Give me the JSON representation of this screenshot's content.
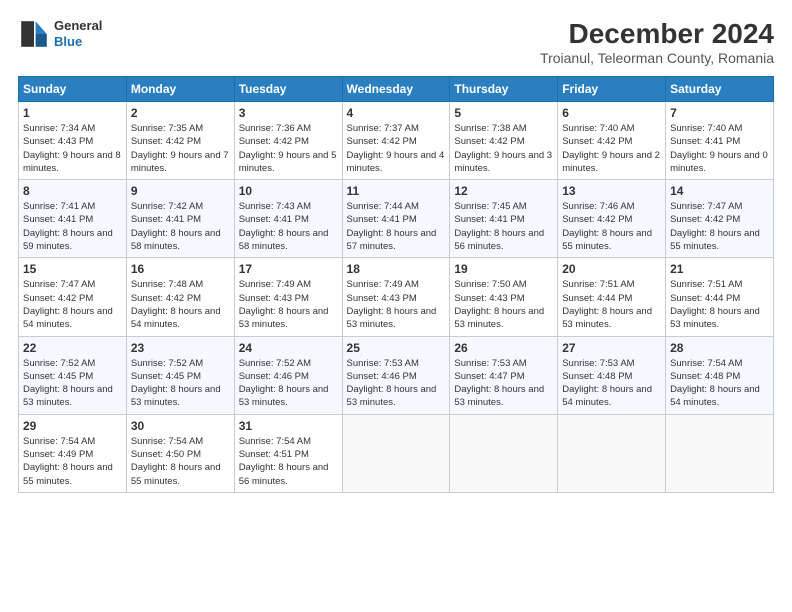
{
  "header": {
    "logo_line1": "General",
    "logo_line2": "Blue",
    "month": "December 2024",
    "location": "Troianul, Teleorman County, Romania"
  },
  "weekdays": [
    "Sunday",
    "Monday",
    "Tuesday",
    "Wednesday",
    "Thursday",
    "Friday",
    "Saturday"
  ],
  "weeks": [
    [
      {
        "day": "1",
        "sunrise": "7:34 AM",
        "sunset": "4:43 PM",
        "daylight": "9 hours and 8 minutes."
      },
      {
        "day": "2",
        "sunrise": "7:35 AM",
        "sunset": "4:42 PM",
        "daylight": "9 hours and 7 minutes."
      },
      {
        "day": "3",
        "sunrise": "7:36 AM",
        "sunset": "4:42 PM",
        "daylight": "9 hours and 5 minutes."
      },
      {
        "day": "4",
        "sunrise": "7:37 AM",
        "sunset": "4:42 PM",
        "daylight": "9 hours and 4 minutes."
      },
      {
        "day": "5",
        "sunrise": "7:38 AM",
        "sunset": "4:42 PM",
        "daylight": "9 hours and 3 minutes."
      },
      {
        "day": "6",
        "sunrise": "7:40 AM",
        "sunset": "4:42 PM",
        "daylight": "9 hours and 2 minutes."
      },
      {
        "day": "7",
        "sunrise": "7:40 AM",
        "sunset": "4:41 PM",
        "daylight": "9 hours and 0 minutes."
      }
    ],
    [
      {
        "day": "8",
        "sunrise": "7:41 AM",
        "sunset": "4:41 PM",
        "daylight": "8 hours and 59 minutes."
      },
      {
        "day": "9",
        "sunrise": "7:42 AM",
        "sunset": "4:41 PM",
        "daylight": "8 hours and 58 minutes."
      },
      {
        "day": "10",
        "sunrise": "7:43 AM",
        "sunset": "4:41 PM",
        "daylight": "8 hours and 58 minutes."
      },
      {
        "day": "11",
        "sunrise": "7:44 AM",
        "sunset": "4:41 PM",
        "daylight": "8 hours and 57 minutes."
      },
      {
        "day": "12",
        "sunrise": "7:45 AM",
        "sunset": "4:41 PM",
        "daylight": "8 hours and 56 minutes."
      },
      {
        "day": "13",
        "sunrise": "7:46 AM",
        "sunset": "4:42 PM",
        "daylight": "8 hours and 55 minutes."
      },
      {
        "day": "14",
        "sunrise": "7:47 AM",
        "sunset": "4:42 PM",
        "daylight": "8 hours and 55 minutes."
      }
    ],
    [
      {
        "day": "15",
        "sunrise": "7:47 AM",
        "sunset": "4:42 PM",
        "daylight": "8 hours and 54 minutes."
      },
      {
        "day": "16",
        "sunrise": "7:48 AM",
        "sunset": "4:42 PM",
        "daylight": "8 hours and 54 minutes."
      },
      {
        "day": "17",
        "sunrise": "7:49 AM",
        "sunset": "4:43 PM",
        "daylight": "8 hours and 53 minutes."
      },
      {
        "day": "18",
        "sunrise": "7:49 AM",
        "sunset": "4:43 PM",
        "daylight": "8 hours and 53 minutes."
      },
      {
        "day": "19",
        "sunrise": "7:50 AM",
        "sunset": "4:43 PM",
        "daylight": "8 hours and 53 minutes."
      },
      {
        "day": "20",
        "sunrise": "7:51 AM",
        "sunset": "4:44 PM",
        "daylight": "8 hours and 53 minutes."
      },
      {
        "day": "21",
        "sunrise": "7:51 AM",
        "sunset": "4:44 PM",
        "daylight": "8 hours and 53 minutes."
      }
    ],
    [
      {
        "day": "22",
        "sunrise": "7:52 AM",
        "sunset": "4:45 PM",
        "daylight": "8 hours and 53 minutes."
      },
      {
        "day": "23",
        "sunrise": "7:52 AM",
        "sunset": "4:45 PM",
        "daylight": "8 hours and 53 minutes."
      },
      {
        "day": "24",
        "sunrise": "7:52 AM",
        "sunset": "4:46 PM",
        "daylight": "8 hours and 53 minutes."
      },
      {
        "day": "25",
        "sunrise": "7:53 AM",
        "sunset": "4:46 PM",
        "daylight": "8 hours and 53 minutes."
      },
      {
        "day": "26",
        "sunrise": "7:53 AM",
        "sunset": "4:47 PM",
        "daylight": "8 hours and 53 minutes."
      },
      {
        "day": "27",
        "sunrise": "7:53 AM",
        "sunset": "4:48 PM",
        "daylight": "8 hours and 54 minutes."
      },
      {
        "day": "28",
        "sunrise": "7:54 AM",
        "sunset": "4:48 PM",
        "daylight": "8 hours and 54 minutes."
      }
    ],
    [
      {
        "day": "29",
        "sunrise": "7:54 AM",
        "sunset": "4:49 PM",
        "daylight": "8 hours and 55 minutes."
      },
      {
        "day": "30",
        "sunrise": "7:54 AM",
        "sunset": "4:50 PM",
        "daylight": "8 hours and 55 minutes."
      },
      {
        "day": "31",
        "sunrise": "7:54 AM",
        "sunset": "4:51 PM",
        "daylight": "8 hours and 56 minutes."
      },
      null,
      null,
      null,
      null
    ]
  ]
}
